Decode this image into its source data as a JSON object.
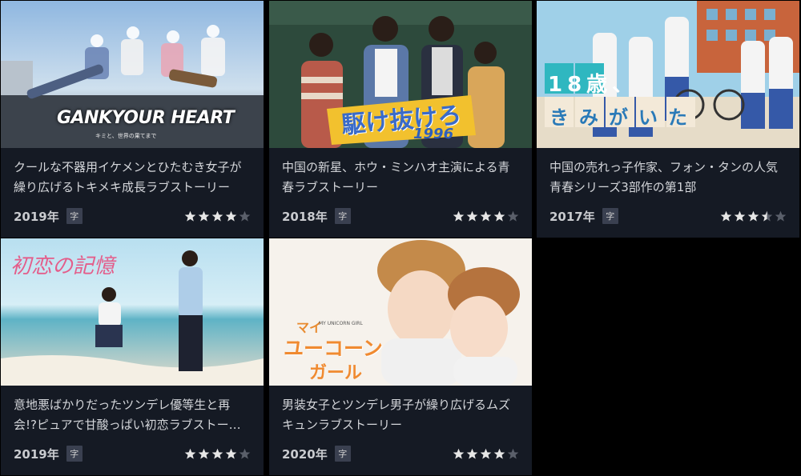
{
  "colors": {
    "background": "#000000",
    "card": "#151a24",
    "star_on": "#e6e6e6",
    "star_off": "#5a5f6a"
  },
  "cards": [
    {
      "thumb_title": "GANKYOUR HEART",
      "thumb_subtitle": "キミと、世界の果てまで",
      "description": "クールな不器用イケメンとひたむき女子が繰り広げるトキメキ成長ラブストーリー",
      "year": "2019年",
      "badge": "字",
      "rating": 4
    },
    {
      "thumb_title": "駆け抜けろ",
      "thumb_subtitle": "1996",
      "description": "中国の新星、ホウ・ミンハオ主演による青春ラブストーリー",
      "year": "2018年",
      "badge": "字",
      "rating": 4
    },
    {
      "thumb_title_a": "18歳、",
      "thumb_title_b": "きみがいた",
      "description": "中国の売れっ子作家、フォン・タンの人気青春シリーズ3部作の第1部",
      "year": "2017年",
      "badge": "字",
      "rating": 3.5
    },
    {
      "thumb_title": "初恋の記憶",
      "description": "意地悪ばかりだったツンデレ優等生と再会!?ピュアで甘酸っぱい初恋ラブストー…",
      "year": "2019年",
      "badge": "字",
      "rating": 4
    },
    {
      "thumb_title_a": "マイ",
      "thumb_title_b": "ユーコーン",
      "thumb_title_c": "ガール",
      "thumb_small": "MY UNICORN GIRL",
      "description": "男装女子とツンデレ男子が繰り広げるムズキュンラブストーリー",
      "year": "2020年",
      "badge": "字",
      "rating": 4
    }
  ]
}
